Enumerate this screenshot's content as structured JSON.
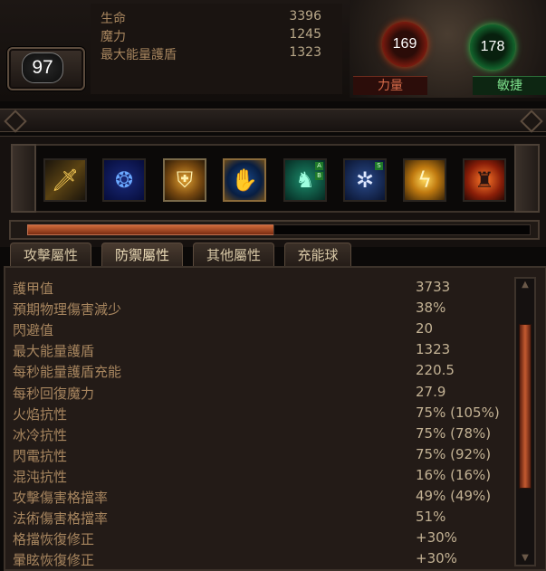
{
  "character": {
    "level": "97",
    "top_stats": [
      {
        "label": "生命",
        "value": "3396"
      },
      {
        "label": "魔力",
        "value": "1245"
      },
      {
        "label": "最大能量護盾",
        "value": "1323"
      }
    ],
    "strength": {
      "value": "169",
      "label": "力量"
    },
    "dexterity": {
      "value": "178",
      "label": "敏捷"
    }
  },
  "skills": [
    {
      "icon": "sword-icon"
    },
    {
      "icon": "blue-rune-icon"
    },
    {
      "icon": "golden-shield-icon"
    },
    {
      "icon": "blue-hand-icon"
    },
    {
      "icon": "green-figure-icon",
      "tags": [
        "A",
        "B"
      ]
    },
    {
      "icon": "ice-nova-icon",
      "tags": [
        "S"
      ]
    },
    {
      "icon": "lightning-arc-icon"
    },
    {
      "icon": "fire-figure-icon"
    }
  ],
  "experience_progress": 0.49,
  "tabs": [
    "攻擊屬性",
    "防禦屬性",
    "其他屬性",
    "充能球"
  ],
  "active_tab": 1,
  "stats": [
    {
      "label": "護甲值",
      "value": "3733"
    },
    {
      "label": "預期物理傷害減少",
      "value": "38%"
    },
    {
      "label": "閃避值",
      "value": "20"
    },
    {
      "label": "最大能量護盾",
      "value": "1323"
    },
    {
      "label": "每秒能量護盾充能",
      "value": "220.5"
    },
    {
      "label": "每秒回復魔力",
      "value": "27.9"
    },
    {
      "label": "火焰抗性",
      "value": "75% (105%)"
    },
    {
      "label": "冰冷抗性",
      "value": "75% (78%)"
    },
    {
      "label": "閃電抗性",
      "value": "75% (92%)"
    },
    {
      "label": "混沌抗性",
      "value": "16% (16%)"
    },
    {
      "label": "攻擊傷害格擋率",
      "value": "49% (49%)"
    },
    {
      "label": "法術傷害格擋率",
      "value": "51%"
    },
    {
      "label": "格擋恢復修正",
      "value": "+30%"
    },
    {
      "label": "暈眩恢復修正",
      "value": "+30%"
    }
  ],
  "colors": {
    "label": "#a8865f",
    "value": "#c3b294",
    "strength": "#d04018",
    "dexterity": "#2fc44f"
  }
}
